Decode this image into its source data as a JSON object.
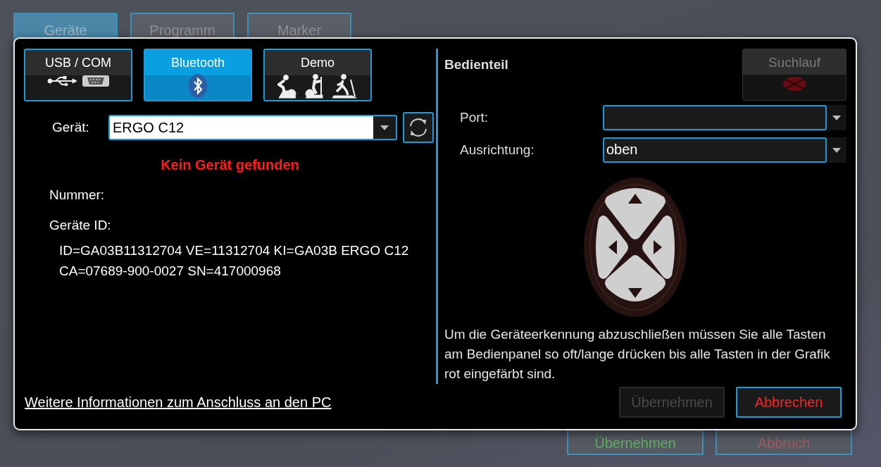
{
  "background_tabs": [
    {
      "label": "Geräte",
      "selected": true
    },
    {
      "label": "Programm",
      "selected": false
    },
    {
      "label": "Marker",
      "selected": false
    }
  ],
  "background_buttons": [
    {
      "label": "Übernehmen",
      "kind": "confirm"
    },
    {
      "label": "Abbruch",
      "kind": "cancel"
    }
  ],
  "dialog": {
    "connection_buttons": [
      {
        "label": "USB / COM",
        "kind": "usb",
        "selected": false
      },
      {
        "label": "Bluetooth",
        "kind": "bluetooth",
        "selected": true
      },
      {
        "label": "Demo",
        "kind": "demo",
        "selected": false
      }
    ],
    "device": {
      "label": "Gerät:",
      "value": "ERGO C12"
    },
    "status": "Kein Gerät gefunden",
    "number_label": "Nummer:",
    "id_label": "Geräte ID:",
    "id_lines": [
      "ID=GA03B11312704 VE=11312704 KI=GA03B ERGO C12",
      "CA=07689-900-0027 SN=417000968"
    ],
    "panel": {
      "title": "Bedienteil",
      "search_button": {
        "label": "Suchlauf",
        "disabled": true
      },
      "fields": [
        {
          "label": "Port:"
        },
        {
          "label": "Ausrichtung:",
          "value": "oben"
        }
      ],
      "instructions": "Um die Geräteerkennung abzuschließen müssen Sie alle Tasten am Bedienpanel so oft/lange drücken bis alle Tasten in der Grafik rot eingefärbt sind."
    },
    "link": "Weitere Informationen zum Anschluss an den PC",
    "buttons": [
      {
        "label": "Übernehmen",
        "kind": "confirm",
        "disabled": true
      },
      {
        "label": "Abbrechen",
        "kind": "cancel",
        "disabled": false
      }
    ]
  }
}
